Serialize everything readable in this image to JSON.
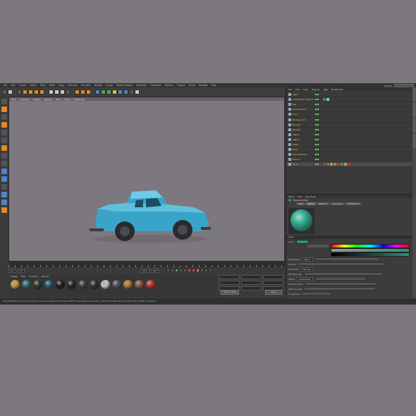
{
  "menu": {
    "items": [
      "File",
      "Edit",
      "Create",
      "Select",
      "Tools",
      "Mesh",
      "Snap",
      "Animate",
      "Simulate",
      "Render",
      "Sculpt",
      "Motion Tracker",
      "MoGraph",
      "Character",
      "Pipeline",
      "Plugins",
      "Script",
      "Window",
      "Help"
    ],
    "highlighted": "Motion Tracker",
    "layout_label": "Layout:"
  },
  "viewport": {
    "menu": [
      "View",
      "Cameras",
      "Display",
      "Options",
      "Filter",
      "Panel",
      "ProRender"
    ],
    "background_color": "#7d7780",
    "car_color": "#3aa4c8"
  },
  "timeline": {
    "start_frame": "0 F",
    "current_frame": "0 F",
    "end_frame": "90 F",
    "end_frame_right": "90 F"
  },
  "material_manager": {
    "menu": [
      "Create",
      "Edit",
      "Function",
      "Texture"
    ],
    "materials": [
      "#d49830",
      "#2f6f6a",
      "#383838",
      "#265f7a",
      "#222222",
      "#2a2a2a",
      "#444444",
      "#353535",
      "#c8c8c8",
      "#555555",
      "#b87a2a",
      "#8a5a3a",
      "#c83030"
    ]
  },
  "coordinates": {
    "apply_label": "Apply",
    "mode_label": "Object (Rel)",
    "size_label": "Size"
  },
  "object_manager": {
    "menu": [
      "File",
      "Edit",
      "View",
      "Objects",
      "Tags",
      "Bookmarks"
    ],
    "objects": [
      {
        "name": "Light"
      },
      {
        "name": "Subdivision Surface"
      },
      {
        "name": "Sky"
      },
      {
        "name": "Environment"
      },
      {
        "name": "Floor"
      },
      {
        "name": "Background"
      },
      {
        "name": "Bumper"
      },
      {
        "name": "Wheels"
      },
      {
        "name": "Lights"
      },
      {
        "name": "Light.1"
      },
      {
        "name": "Glass"
      },
      {
        "name": "Body"
      },
      {
        "name": "Door Handles"
      },
      {
        "name": "Mirrors"
      },
      {
        "name": "Body"
      }
    ]
  },
  "attributes": {
    "menu": [
      "Mode",
      "Edit",
      "User Data"
    ],
    "material_name": "Material [Mat]",
    "tabs": [
      "Basic",
      "Color",
      "Diffusion",
      "Luminance",
      "Reflectance"
    ],
    "section_color": "Color",
    "color_label": "Color",
    "brightness_label": "Brightness",
    "brightness_value": "100 %",
    "texture_label": "Texture",
    "mix_mode_label": "Mix Mode",
    "mix_mode_value": "Normal",
    "mix_strength_label": "Mix Strength",
    "model_label": "Model",
    "model_value": "Lambertian",
    "diffuse_falloff_label": "Diffuse Falloff",
    "diffuse_level_label": "Diffuse Level",
    "roughness_label": "Roughness"
  },
  "status": {
    "text": "00:00:00 Move: Click and drag to move elements. Hold down SHIFT to quantize movement / add to the selection in point mode, CTRL to remove."
  }
}
